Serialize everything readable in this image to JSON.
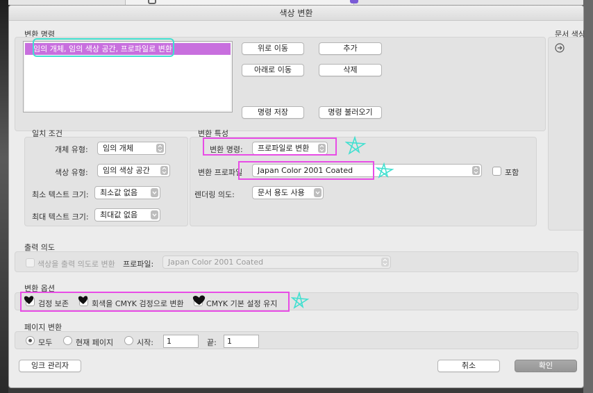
{
  "dialog": {
    "title": "색상 변환"
  },
  "command_section": {
    "label": "변환 명령",
    "selected_item": "임의 개체, 임의 색상 공간, 프로파일로 변환",
    "buttons": {
      "move_up": "위로 이동",
      "move_down": "아래로 이동",
      "add": "추가",
      "delete": "삭제",
      "save": "명령 저장",
      "load": "명령 불러오기"
    }
  },
  "document_colors": {
    "label": "문서 색상"
  },
  "match_criteria": {
    "label": "일치 조건",
    "object_type_label": "개체 유형:",
    "object_type_value": "임의 개체",
    "color_type_label": "색상 유형:",
    "color_type_value": "임의 색상 공간",
    "min_text_label": "최소 텍스트 크기:",
    "min_text_value": "최소값 없음",
    "max_text_label": "최대 텍스트 크기:",
    "max_text_value": "최대값 없음"
  },
  "conversion_attributes": {
    "label": "변환 특성",
    "command_label": "변환 명령:",
    "command_value": "프로파일로 변환",
    "profile_label": "변환 프로파일",
    "profile_value": "Japan Color 2001 Coated",
    "embed_label": "포함",
    "rendering_label": "렌더링 의도:",
    "rendering_value": "문서 용도 사용"
  },
  "output_intent": {
    "label": "출력 의도",
    "convert_checkbox_label": "색상을 출력 의도로 변환",
    "profile_label": "프로파일:",
    "profile_value": "Japan Color 2001 Coated"
  },
  "conversion_options": {
    "label": "변환 옵션",
    "preserve_black": "검정 보존",
    "promote_gray": "회색을 CMYK 검정으로 변환",
    "preserve_cmyk": "CMYK 기본 설정 유지"
  },
  "page_conversion": {
    "label": "페이지 변환",
    "all": "모두",
    "current_page": "현재 페이지",
    "from_label": "시작:",
    "from_value": "1",
    "to_label": "끝:",
    "to_value": "1",
    "selected": "all"
  },
  "footer": {
    "ink_manager": "잉크 관리자",
    "cancel": "취소",
    "ok": "확인"
  },
  "colors": {
    "selection": "#c86fde",
    "annotation_box": "#e84ce6",
    "annotation_marker": "#41e0d0"
  },
  "icons": {
    "arrow_circle": "arrow-right-circle-icon",
    "popup_stepper": "up-down-stepper-icon"
  }
}
